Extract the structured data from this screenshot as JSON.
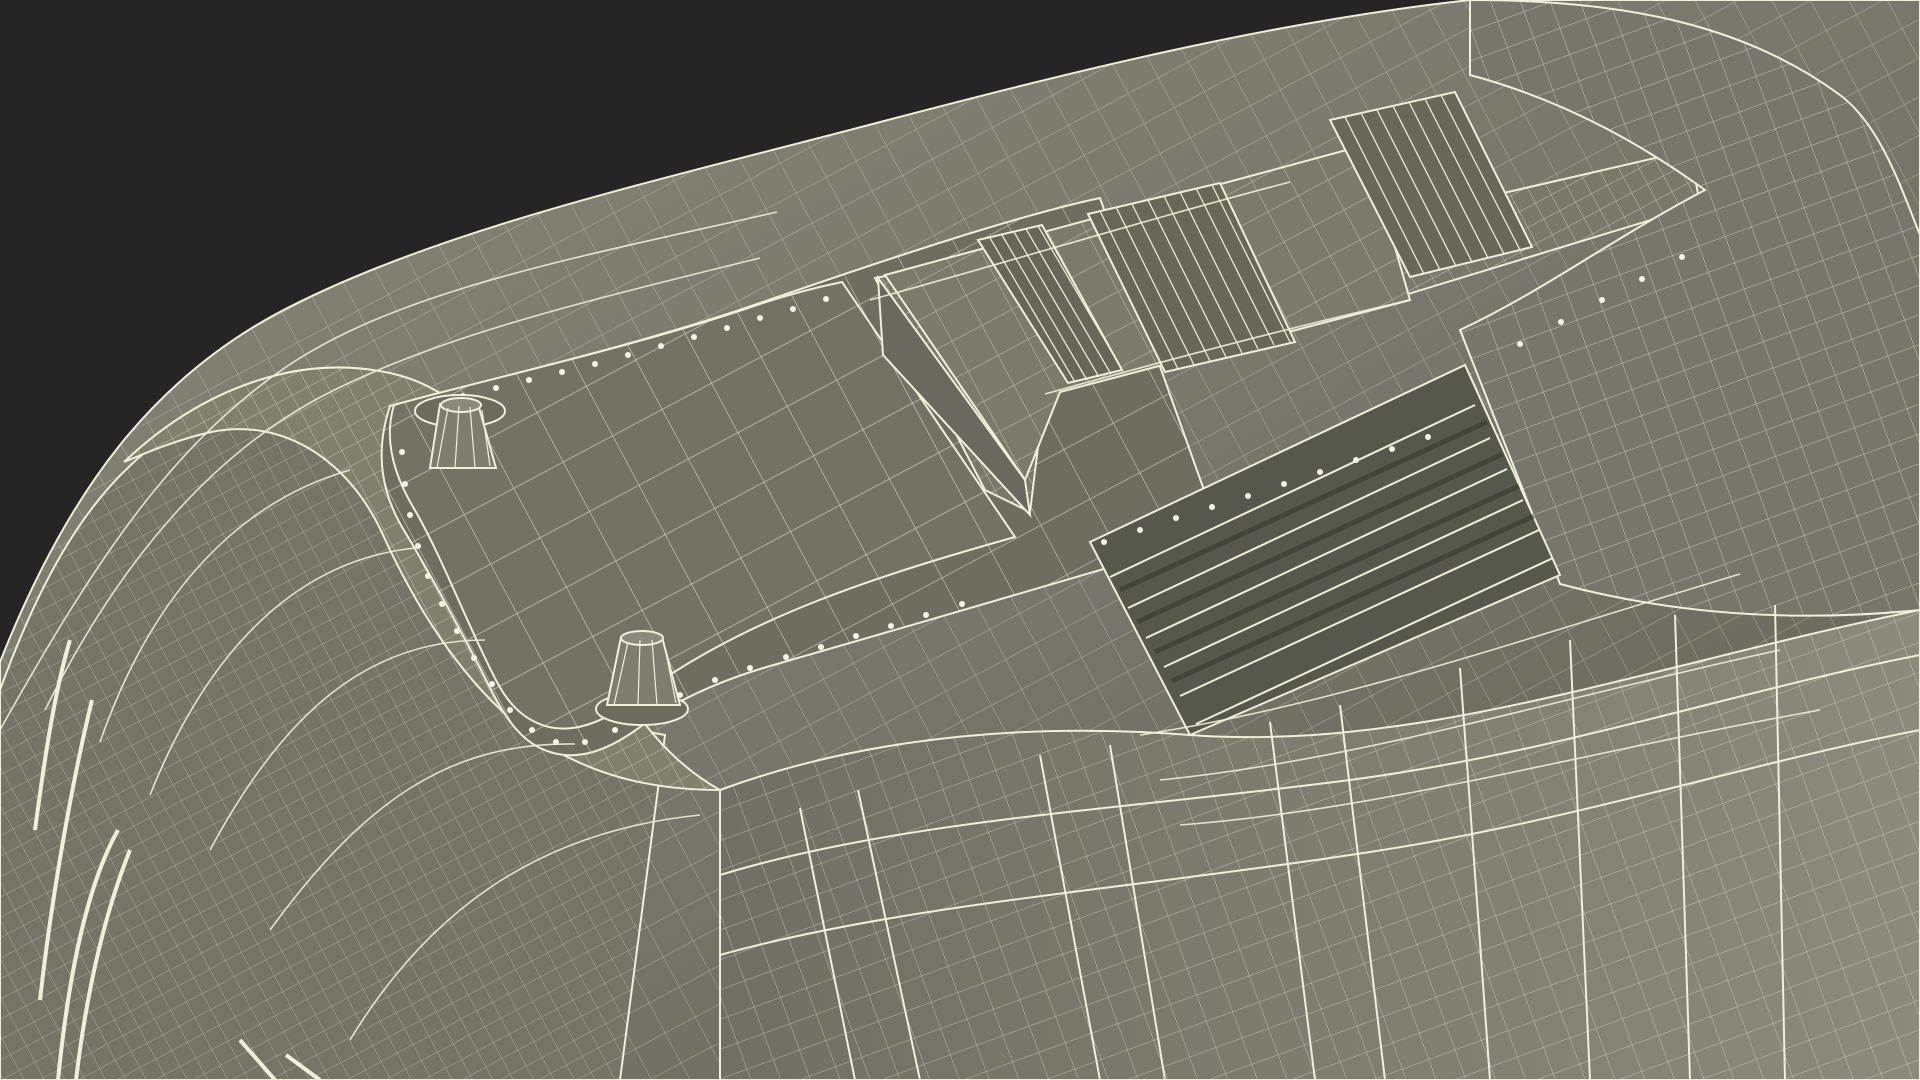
{
  "scene": {
    "title": "",
    "background_color": "#252525",
    "model_color": "#7b7b6d",
    "model_dark_color": "#60604f",
    "wire_color": "#efefdc",
    "wire_soft_color": "#c8c8b6"
  }
}
